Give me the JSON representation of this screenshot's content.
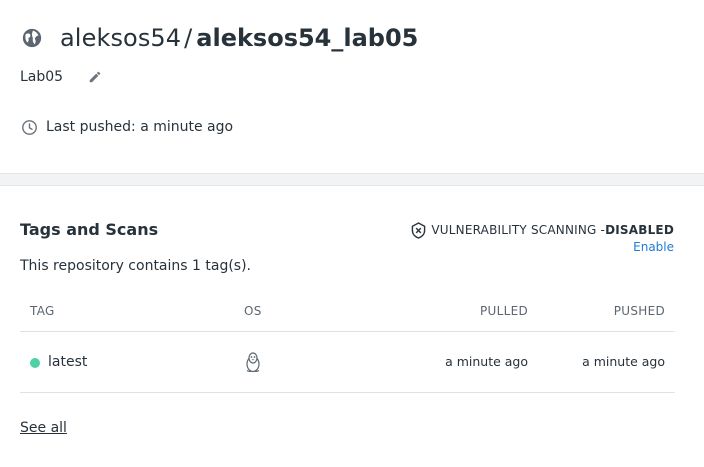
{
  "repo": {
    "namespace": "aleksos54",
    "separator": "/",
    "name": "aleksos54_lab05",
    "description": "Lab05",
    "last_pushed": "Last pushed: a minute ago"
  },
  "tags_section": {
    "title": "Tags and Scans",
    "vuln_label": "VULNERABILITY SCANNING - ",
    "vuln_status": "DISABLED",
    "enable_link": "Enable",
    "count_text": "This repository contains 1 tag(s).",
    "columns": {
      "tag": "TAG",
      "os": "OS",
      "pulled": "PULLED",
      "pushed": "PUSHED"
    },
    "rows": [
      {
        "tag": "latest",
        "os_icon": "linux-icon",
        "pulled": "a minute ago",
        "pushed": "a minute ago",
        "status_color": "#4fd1a5"
      }
    ],
    "see_all": "See all"
  },
  "colors": {
    "link": "#1d7ccf",
    "status_dot": "#4fd1a5",
    "text": "#27323b"
  },
  "icons": {
    "public": "globe-icon",
    "edit": "pencil-icon",
    "time": "clock-icon",
    "scan": "shield-icon"
  }
}
